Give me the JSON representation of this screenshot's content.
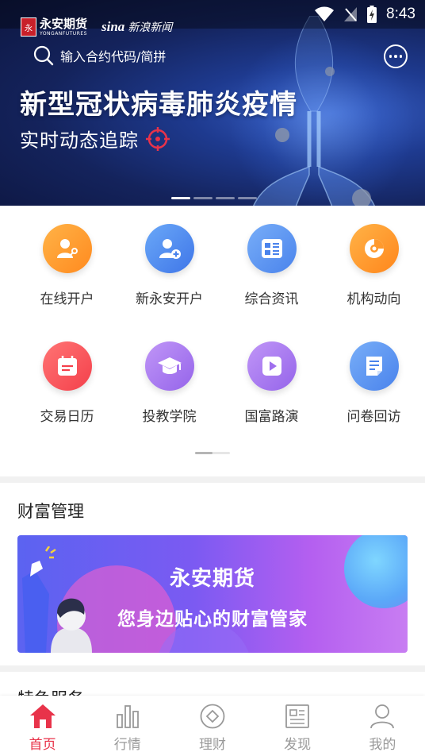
{
  "status_bar": {
    "time": "8:43"
  },
  "header": {
    "logo_yongan_cn": "永安期货",
    "logo_yongan_en": "YONGANFUTURES",
    "logo_sina_en": "sina",
    "logo_sina_cn": "新浪新闻",
    "search_placeholder": "输入合约代码/简拼"
  },
  "hero": {
    "title": "新型冠状病毒肺炎疫情",
    "subtitle": "实时动态追踪",
    "slide_count": 4,
    "active_slide": 1
  },
  "functions": [
    [
      {
        "label": "在线开户",
        "icon": "user-key-icon",
        "color_from": "#ffa83d",
        "color_to": "#ff8a1f"
      },
      {
        "label": "新永安开户",
        "icon": "user-add-icon",
        "color_from": "#5b9cf5",
        "color_to": "#3f76e8"
      },
      {
        "label": "综合资讯",
        "icon": "news-list-icon",
        "color_from": "#6aa5f7",
        "color_to": "#4a83ec"
      },
      {
        "label": "机构动向",
        "icon": "pie-chart-icon",
        "color_from": "#ffa63b",
        "color_to": "#ff861c"
      }
    ],
    [
      {
        "label": "交易日历",
        "icon": "calendar-icon",
        "color_from": "#ff6a6a",
        "color_to": "#f4404b"
      },
      {
        "label": "投教学院",
        "icon": "graduation-cap-icon",
        "color_from": "#b88af5",
        "color_to": "#9564ea"
      },
      {
        "label": "国富路演",
        "icon": "play-icon",
        "color_from": "#b88af5",
        "color_to": "#9564ea"
      },
      {
        "label": "问卷回访",
        "icon": "questionnaire-icon",
        "color_from": "#6aa5f7",
        "color_to": "#4a83ec"
      }
    ]
  ],
  "wealth": {
    "section_title": "财富管理",
    "banner_title": "永安期货",
    "banner_subtitle": "您身边贴心的财富管家"
  },
  "featured": {
    "section_title": "特色服务"
  },
  "tabs": [
    {
      "label": "首页",
      "icon": "home-icon",
      "active": true
    },
    {
      "label": "行情",
      "icon": "bar-chart-icon",
      "active": false
    },
    {
      "label": "理财",
      "icon": "wealth-coin-icon",
      "active": false
    },
    {
      "label": "发现",
      "icon": "newspaper-icon",
      "active": false
    },
    {
      "label": "我的",
      "icon": "profile-icon",
      "active": false
    }
  ],
  "colors": {
    "accent": "#e8334a",
    "tab_inactive": "#999999"
  }
}
